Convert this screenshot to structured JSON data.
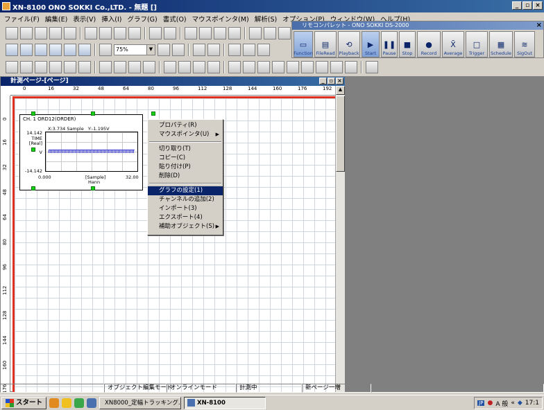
{
  "window": {
    "title": "XN-8100 ONO SOKKI Co.,LTD. - 無題 []"
  },
  "menubar": [
    "ファイル(F)",
    "編集(E)",
    "表示(V)",
    "挿入(I)",
    "グラフ(G)",
    "書式(O)",
    "マウスポインタ(M)",
    "解析(S)",
    "オプション(P)",
    "ウィンドウ(W)",
    "ヘルプ(H)"
  ],
  "toolbar": {
    "zoom_value": "75%"
  },
  "palette": {
    "title": "リモコンパレット - ONO SOKKI DS-2000",
    "buttons": [
      "Function",
      "FileRead",
      "Playback",
      "Start",
      "Pause",
      "Stop",
      "Record",
      "Average",
      "Trigger",
      "Schedule",
      "SigOut"
    ]
  },
  "document": {
    "title": "計測ページ-[ページ]",
    "h_ruler": [
      "0",
      "16",
      "32",
      "48",
      "64",
      "80",
      "96",
      "112",
      "128",
      "144",
      "160",
      "176",
      "192"
    ],
    "v_ruler": [
      "0",
      "16",
      "32",
      "48",
      "64",
      "80",
      "96",
      "112",
      "128",
      "144",
      "160",
      "176"
    ]
  },
  "graph": {
    "title": "CH. 1  ORD12(ORDER)",
    "cursor_x": "X:3.734 Sample",
    "cursor_y": "Y:-1.195V",
    "y_top": "14.142",
    "y_label1": "TIME",
    "y_label2": "[Real]",
    "y_unit": "V",
    "y_bottom": "-14.142",
    "x_start": "0.000",
    "x_end": "32.00",
    "x_unit": "[Sample]",
    "window_fn": "Hann"
  },
  "context_menu": {
    "items": [
      "プロパティ(R)",
      "マウスポインタ(U)",
      "切り取り(T)",
      "コピー(C)",
      "貼り付け(P)",
      "削除(D)",
      "グラフの設定(1)",
      "チャンネルの追加(2)",
      "インポート(3)",
      "エクスポート(4)",
      "補助オブジェクト(S)"
    ]
  },
  "statusbar": [
    "オブジェクト編集モード",
    "オンラインモード",
    "計測中",
    "新ページ一増"
  ],
  "taskbar": {
    "start_label": "スタート",
    "items": [
      "XN8000_定幅トラッキング...",
      "XN-8100"
    ],
    "tray_ime": "A 般",
    "clock": "17:1"
  }
}
